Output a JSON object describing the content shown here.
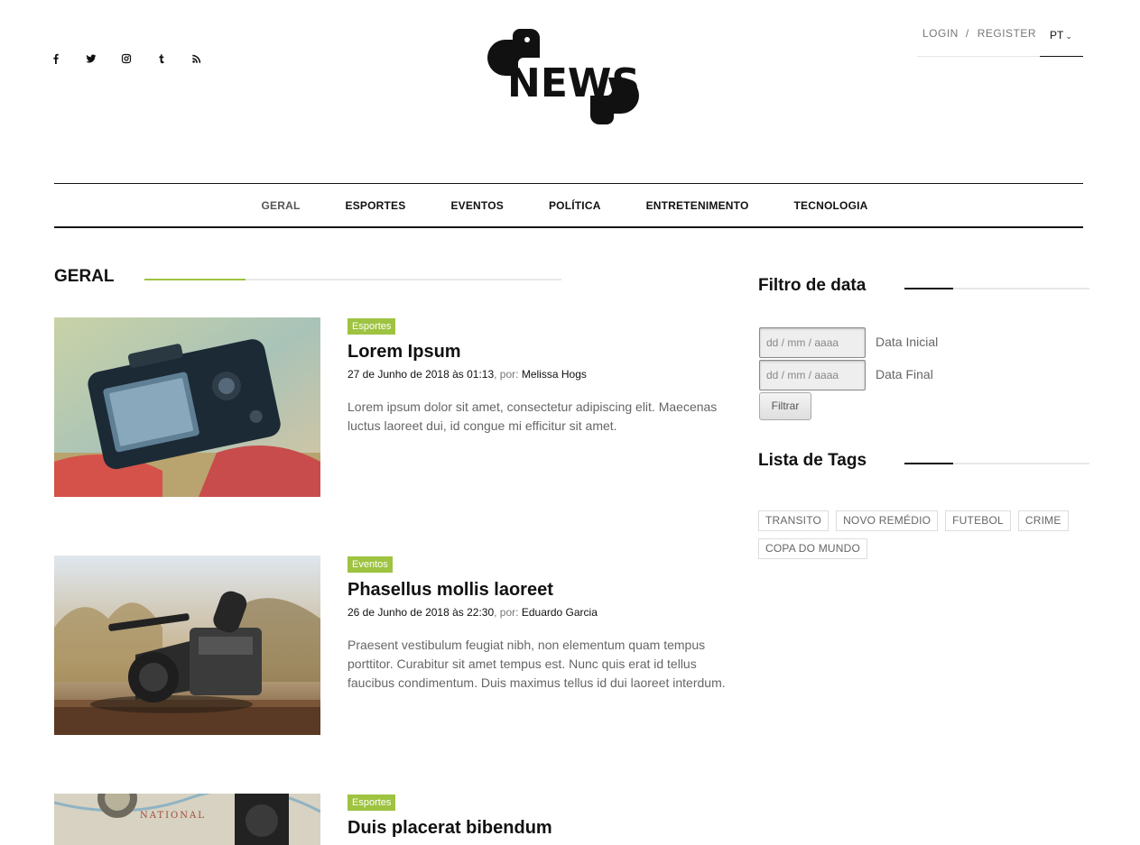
{
  "header": {
    "social": [
      {
        "name": "facebook-icon",
        "glyph": "f"
      },
      {
        "name": "twitter-icon",
        "glyph": "t"
      },
      {
        "name": "instagram-icon",
        "glyph": "i"
      },
      {
        "name": "tumblr-icon",
        "glyph": "t"
      },
      {
        "name": "rss-icon",
        "glyph": "r"
      }
    ],
    "logo_text": "NEWS",
    "login_label": "LOGIN",
    "separator": "/",
    "register_label": "REGISTER",
    "language": "PT"
  },
  "nav": {
    "items": [
      "GERAL",
      "ESPORTES",
      "EVENTOS",
      "POLÍTICA",
      "ENTRETENIMENTO",
      "TECNOLOGIA"
    ],
    "active": "GERAL"
  },
  "main": {
    "section_title": "GERAL",
    "articles": [
      {
        "category": "Esportes",
        "title": "Lorem Ipsum",
        "date": "27 de Junho de 2018 às 01:13",
        "by_label": ", por:",
        "author": "Melissa Hogs",
        "excerpt": "Lorem ipsum dolor sit amet, consectetur adipiscing elit. Maecenas luctus laoreet dui, id congue mi efficitur sit amet.",
        "image": "camera-photo"
      },
      {
        "category": "Eventos",
        "title": "Phasellus mollis laoreet",
        "date": "26 de Junho de 2018 às 22:30",
        "by_label": ", por:",
        "author": "Eduardo Garcia",
        "excerpt": "Praesent vestibulum feugiat nibh, non elementum quam tempus porttitor. Curabitur sit amet tempus est. Nunc quis erat id tellus faucibus condimentum. Duis maximus tellus id dui laoreet interdum.",
        "image": "video-camera-photo"
      },
      {
        "category": "Esportes",
        "title": "Duis placerat bibendum",
        "image": "map-and-lens-photo",
        "image_text": "NATIONAL"
      }
    ]
  },
  "sidebar": {
    "date_filter_title": "Filtro de data",
    "date_placeholder": "dd / mm / aaaa",
    "start_label": "Data Inicial",
    "end_label": "Data Final",
    "filter_button": "Filtrar",
    "tags_title": "Lista de Tags",
    "tags": [
      "TRANSITO",
      "NOVO REMÉDIO",
      "FUTEBOL",
      "CRIME",
      "COPA DO MUNDO"
    ]
  },
  "colors": {
    "accent": "#9ec341",
    "text": "#111111",
    "muted": "#666666"
  }
}
